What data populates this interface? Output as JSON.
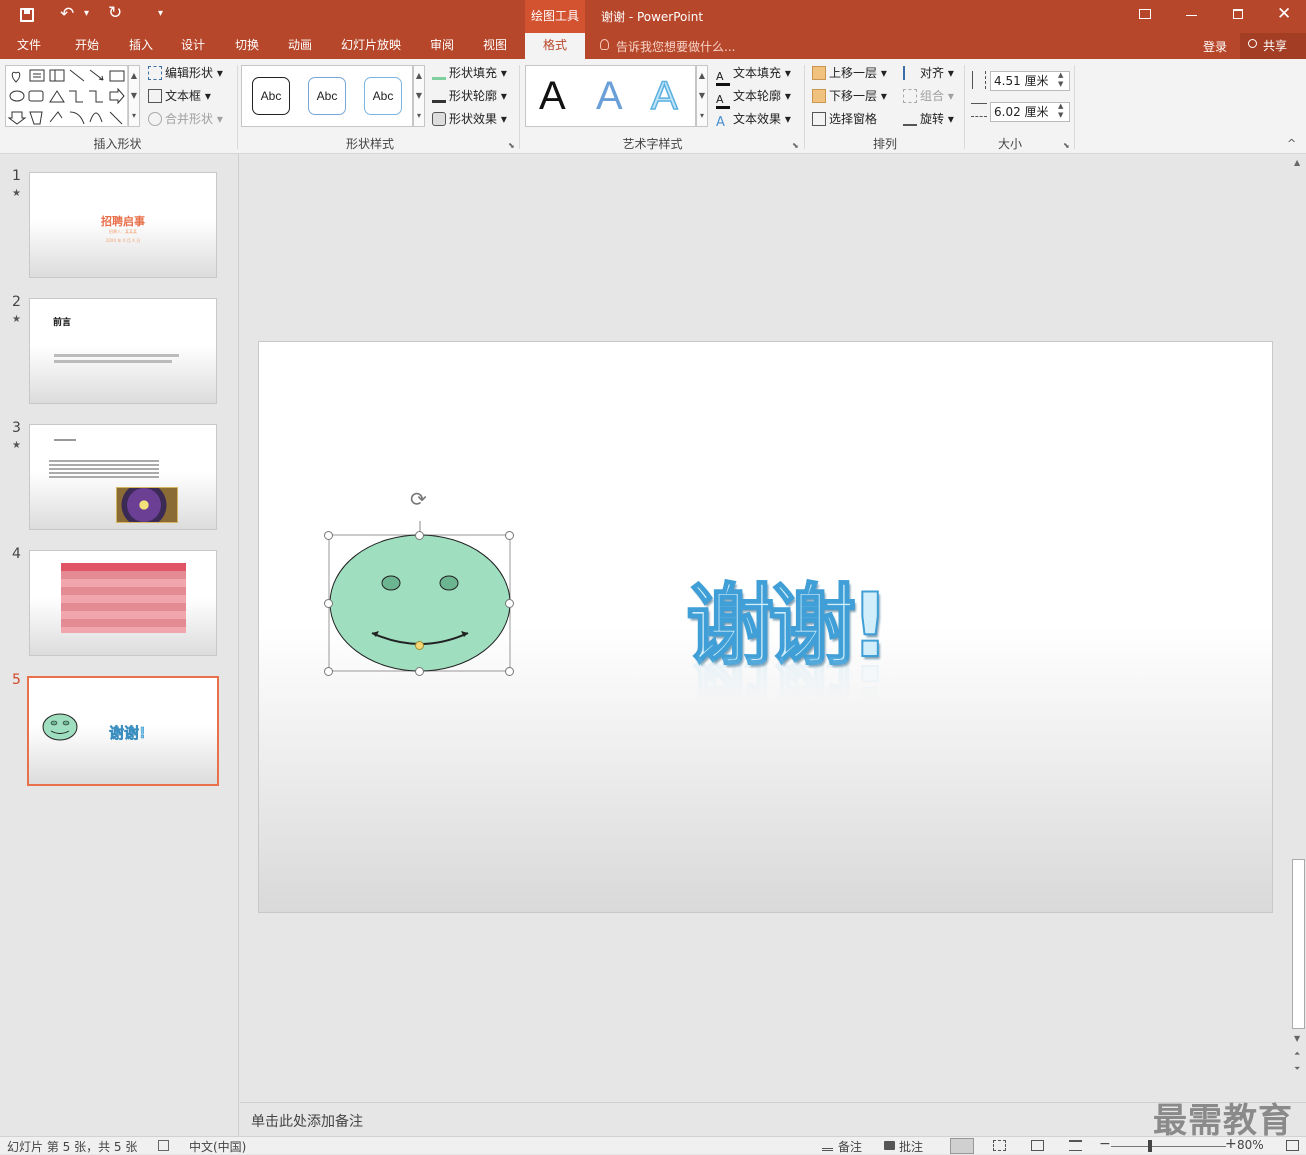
{
  "titlebar": {
    "context_tab": "绘图工具",
    "title": "谢谢 - PowerPoint",
    "qat_more": "▾"
  },
  "tabs": [
    {
      "label": "文件"
    },
    {
      "label": "开始"
    },
    {
      "label": "插入"
    },
    {
      "label": "设计"
    },
    {
      "label": "切换"
    },
    {
      "label": "动画"
    },
    {
      "label": "幻灯片放映"
    },
    {
      "label": "审阅"
    },
    {
      "label": "视图"
    },
    {
      "label": "格式"
    }
  ],
  "tellme": "告诉我您想要做什么...",
  "signin": "登录",
  "share": "共享",
  "ribbon": {
    "insert_shapes": {
      "label": "插入形状",
      "edit_shape": "编辑形状",
      "text_box": "文本框",
      "merge_shapes": "合并形状"
    },
    "shape_styles": {
      "label": "形状样式",
      "abc": "Abc",
      "fill": "形状填充",
      "outline": "形状轮廓",
      "effects": "形状效果"
    },
    "wordart": {
      "label": "艺术字样式",
      "letter": "A",
      "text_fill": "文本填充",
      "text_outline": "文本轮廓",
      "text_effects": "文本效果"
    },
    "arrange": {
      "label": "排列",
      "bring_forward": "上移一层",
      "send_backward": "下移一层",
      "selection_pane": "选择窗格",
      "align": "对齐",
      "group": "组合",
      "rotate": "旋转"
    },
    "size": {
      "label": "大小",
      "height": "4.51 厘米",
      "width": "6.02 厘米"
    }
  },
  "thumbnails": [
    {
      "num": "1",
      "title": "招聘启事",
      "sub1": "招聘人：某某某",
      "sub2": "20XX 年 X 月 X 日"
    },
    {
      "num": "2",
      "title": "前言"
    },
    {
      "num": "3"
    },
    {
      "num": "4"
    },
    {
      "num": "5",
      "text": "谢谢!"
    }
  ],
  "slide": {
    "text": "谢谢!"
  },
  "notes_placeholder": "单击此处添加备注",
  "status": {
    "slide_info": "幻灯片 第 5 张，共 5 张",
    "language": "中文(中国)",
    "notes": "备注",
    "comments": "批注",
    "zoom": "80%"
  },
  "watermark": "最需教育",
  "colors": {
    "accent": "#b7472a",
    "face": "#9fdfc0",
    "wordart": "#4aaee0",
    "selected_thumb": "#e8704a"
  }
}
